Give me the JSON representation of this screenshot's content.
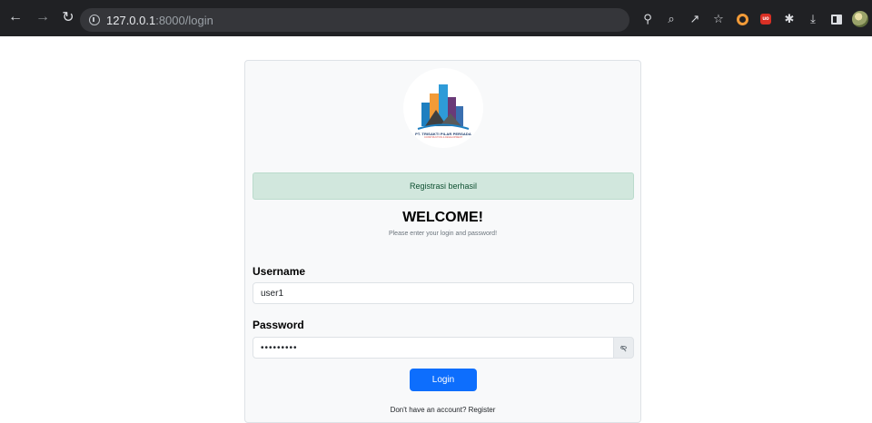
{
  "browser": {
    "url_host": "127.0.0.1",
    "url_rest": ":8000/login",
    "icons": [
      "back-arrow",
      "forward-arrow",
      "reload",
      "info",
      "key",
      "zoom",
      "share",
      "star",
      "extension-orange",
      "extension-red",
      "puzzle",
      "download",
      "side-panel",
      "profile-avatar"
    ]
  },
  "logo": {
    "company": "PT. TRISAKTI PILAR PERSADA",
    "tagline": "CONSTRUCTION & DEVELOPMENT"
  },
  "alert": {
    "message": "Registrasi berhasil",
    "color": "#d1e7dd"
  },
  "heading": {
    "title": "WELCOME!",
    "subtitle": "Please enter your login and password!"
  },
  "form": {
    "username_label": "Username",
    "username_value": "user1",
    "password_label": "Password",
    "password_value": "•••••••••",
    "login_label": "Login"
  },
  "footer": {
    "prompt": "Don't have an account?",
    "register_label": "Register"
  },
  "colors": {
    "primary": "#0d6efd",
    "browser_bar": "#202124"
  }
}
